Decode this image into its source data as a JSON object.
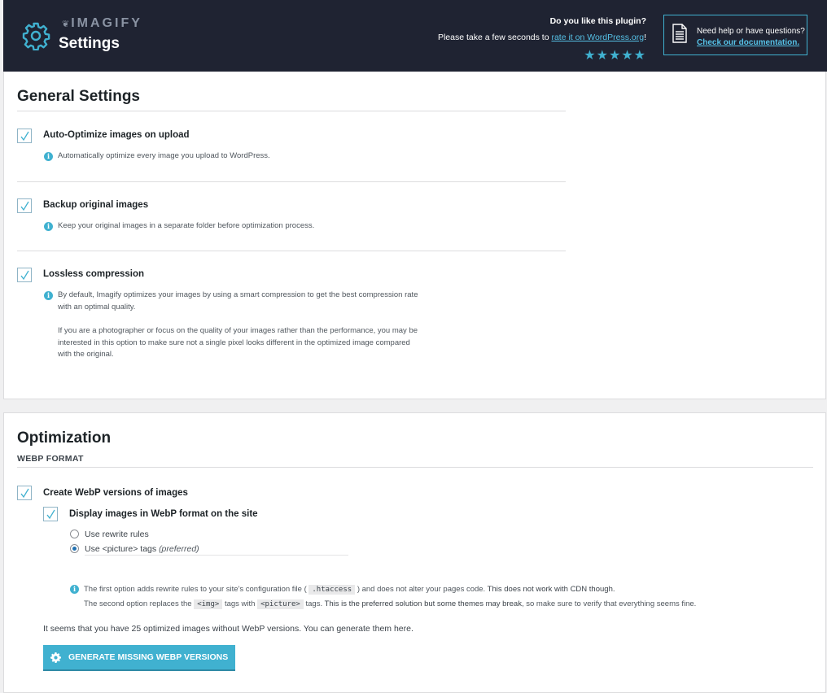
{
  "header": {
    "brand": "IMAGIFY",
    "title": "Settings",
    "rate_question": "Do you like this plugin?",
    "rate_prefix": "Please take a few seconds to ",
    "rate_link": "rate it on WordPress.org",
    "rate_suffix": "!",
    "stars": "★★★★★",
    "help_text": "Need help or have questions?",
    "help_link": "Check our documentation."
  },
  "general": {
    "title": "General Settings",
    "options": [
      {
        "label": "Auto-Optimize images on upload",
        "checked": true,
        "desc": "Automatically optimize every image you upload to WordPress."
      },
      {
        "label": "Backup original images",
        "checked": true,
        "desc": "Keep your original images in a separate folder before optimization process."
      },
      {
        "label": "Lossless compression",
        "checked": true,
        "desc": "By default, Imagify optimizes your images by using a smart compression to get the best compression rate with an optimal quality.",
        "desc2": "If you are a photographer or focus on the quality of your images rather than the performance, you may be interested in this option to make sure not a single pixel looks different in the optimized image compared with the original."
      }
    ]
  },
  "optimization": {
    "title": "Optimization",
    "subhead": "WEBP FORMAT",
    "create_webp_label": "Create WebP versions of images",
    "display_webp_label": "Display images in WebP format on the site",
    "radio_rewrite": "Use rewrite rules",
    "radio_picture": "Use <picture> tags",
    "radio_picture_pref": "(preferred)",
    "selected": "picture",
    "info_1a": "The first option adds rewrite rules to your site's configuration file (",
    "info_1_code": ".htaccess",
    "info_1b": ") and does not alter your pages code.",
    "info_1c": "This does not work with CDN though.",
    "info_2a": "The second option replaces the",
    "info_2_code1": "<img>",
    "info_2b": "tags with",
    "info_2_code2": "<picture>",
    "info_2c": "tags.",
    "info_2d": "This is the preferred solution but some themes may break",
    "info_2e": ", so make sure to verify that everything seems fine.",
    "missing_text": "It seems that you have 25 optimized images without WebP versions. You can generate them here.",
    "generate_button": "GENERATE MISSING WEBP VERSIONS"
  }
}
